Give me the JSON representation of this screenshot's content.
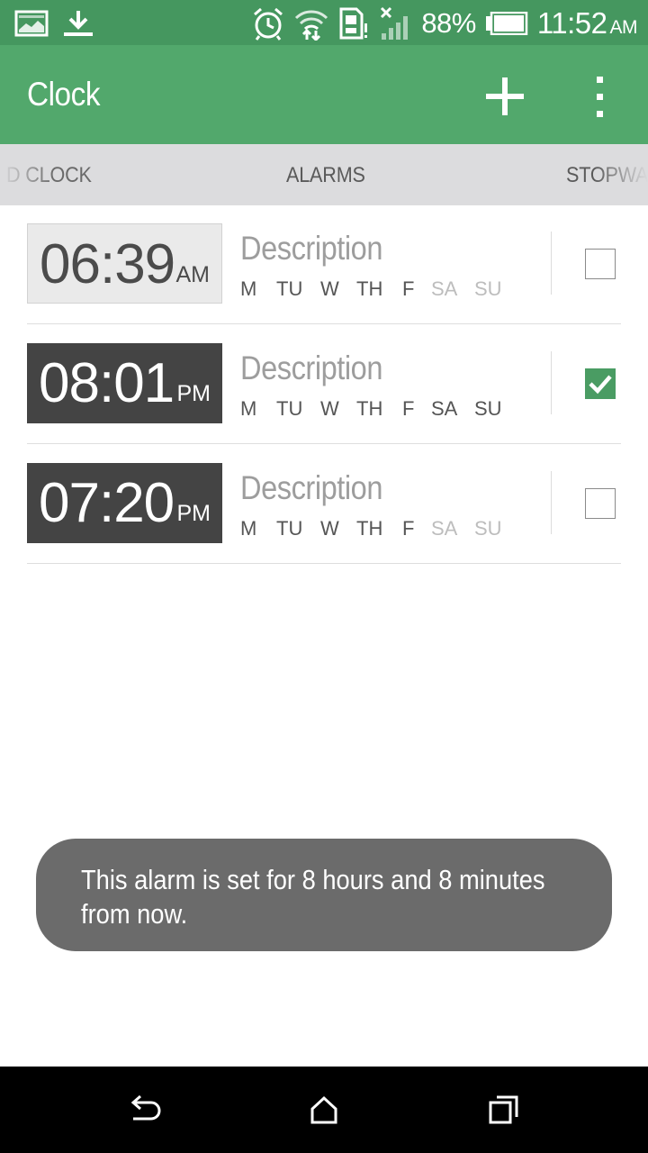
{
  "status_bar": {
    "notification_icons": [
      "image-icon",
      "download-icon"
    ],
    "system_icons": [
      "alarm-icon",
      "sync-wifi-icon",
      "sim-alert-icon",
      "signal-icon",
      "battery-icon"
    ],
    "battery": "88%",
    "time": "11:52",
    "ampm": "AM"
  },
  "action_bar": {
    "title": "Clock",
    "add_icon": "plus-icon",
    "overflow_icon": "more-vert-icon"
  },
  "tabs": [
    {
      "label": "D CLOCK",
      "selected": false
    },
    {
      "label": "ALARMS",
      "selected": true
    },
    {
      "label": "STOPWA",
      "selected": false
    }
  ],
  "alarms": [
    {
      "time": "06:39",
      "ampm": "AM",
      "description": "Description",
      "enabled": false,
      "days": [
        {
          "label": "M",
          "active": true
        },
        {
          "label": "TU",
          "active": true
        },
        {
          "label": "W",
          "active": true
        },
        {
          "label": "TH",
          "active": true
        },
        {
          "label": "F",
          "active": true
        },
        {
          "label": "SA",
          "active": false
        },
        {
          "label": "SU",
          "active": false
        }
      ]
    },
    {
      "time": "08:01",
      "ampm": "PM",
      "description": "Description",
      "enabled": true,
      "days": [
        {
          "label": "M",
          "active": true
        },
        {
          "label": "TU",
          "active": true
        },
        {
          "label": "W",
          "active": true
        },
        {
          "label": "TH",
          "active": true
        },
        {
          "label": "F",
          "active": true
        },
        {
          "label": "SA",
          "active": true
        },
        {
          "label": "SU",
          "active": true
        }
      ]
    },
    {
      "time": "07:20",
      "ampm": "PM",
      "description": "Description",
      "enabled": false,
      "days": [
        {
          "label": "M",
          "active": true
        },
        {
          "label": "TU",
          "active": true
        },
        {
          "label": "W",
          "active": true
        },
        {
          "label": "TH",
          "active": true
        },
        {
          "label": "F",
          "active": true
        },
        {
          "label": "SA",
          "active": false
        },
        {
          "label": "SU",
          "active": false
        }
      ]
    }
  ],
  "toast": {
    "message": "This alarm is set for 8 hours and 8 minutes from now."
  },
  "nav_bar": {
    "icons": [
      "back-icon",
      "home-icon",
      "recents-icon"
    ]
  },
  "colors": {
    "status_bar": "#45975F",
    "action_bar": "#52A86C",
    "tab_bar": "#DCDCDE",
    "checkbox_checked": "#4A9C63",
    "time_box_on": "#444444",
    "time_box_off": "#EAEAEA",
    "toast": "#6B6B6B"
  }
}
